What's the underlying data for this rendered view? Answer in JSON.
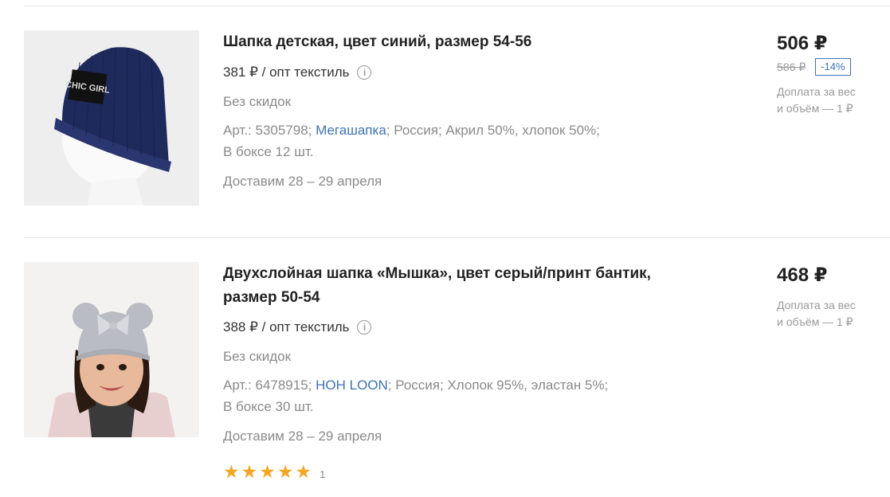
{
  "colors": {
    "accent": "#3d73b7",
    "star": "#f5a623",
    "muted": "#8a8a8a"
  },
  "products": [
    {
      "title": "Шапка детская, цвет синий, размер 54-56",
      "wholesale": "381 ₽ / опт текстиль",
      "discount": "Без скидок",
      "specs_prefix": "Арт.: 5305798; ",
      "brand": "Мегашапка",
      "specs_suffix": "; Россия; Акрил 50%, хлопок 50%;",
      "box": "В боксе 12 шт.",
      "delivery": "Доставим 28 – 29 апреля",
      "price": "506 ₽",
      "old_price": "586 ₽",
      "discount_badge": "-14%",
      "surcharge_line1": "Доплата за вес",
      "surcharge_line2": "и объём — 1 ₽",
      "image_text": "CHIC GIRL"
    },
    {
      "title_line1": "Двухслойная шапка «Мышка», цвет серый/принт бантик,",
      "title_line2": "размер 50-54",
      "wholesale": "388 ₽ / опт текстиль",
      "discount": "Без скидок",
      "specs_prefix": "Арт.: 6478915; ",
      "brand": "HOH LOON",
      "specs_suffix": "; Россия; Хлопок 95%, эластан 5%;",
      "box": "В боксе 30 шт.",
      "delivery": "Доставим 28 – 29 апреля",
      "price": "468 ₽",
      "surcharge_line1": "Доплата за вес",
      "surcharge_line2": "и объём — 1 ₽",
      "rating_stars": 5,
      "rating_count": "1"
    }
  ],
  "icons": {
    "info": "info-circle-icon",
    "star": "star-icon"
  }
}
